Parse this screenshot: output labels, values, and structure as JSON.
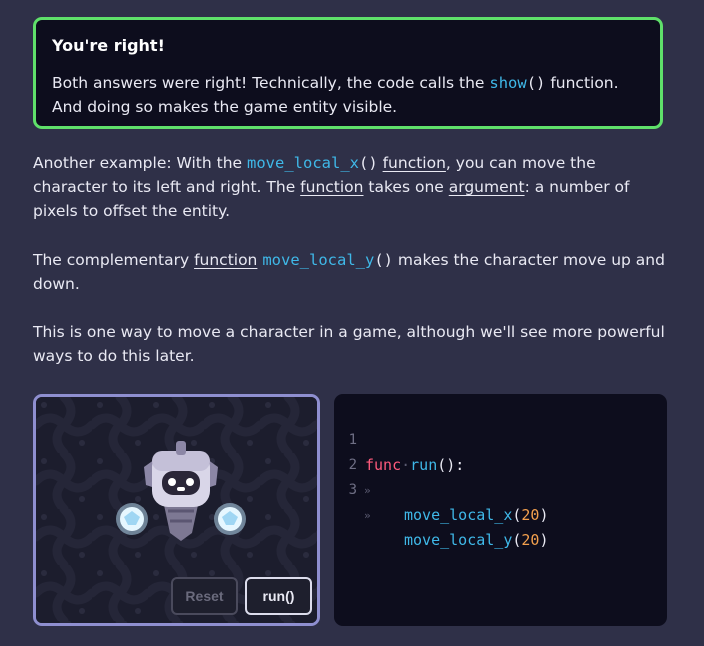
{
  "callout": {
    "title": "You're right!",
    "body_before": "Both answers were right! Technically, the code calls the ",
    "code": "show",
    "parens": "()",
    "body_after": " function. And doing so makes the game entity visible."
  },
  "paragraph1": {
    "t1": "Another example: With the ",
    "code": "move_local_x",
    "parens": "()",
    "space": " ",
    "link1": "function",
    "t2": ", you can move the character to its left and right. The ",
    "link2": "function",
    "t3": " takes one ",
    "link3": "argument",
    "t4": ": a number of pixels to offset the entity."
  },
  "paragraph2": {
    "t1": "The complementary ",
    "link1": "function",
    "space": " ",
    "code": "move_local_y",
    "parens": "()",
    "t2": " makes the character move up and down."
  },
  "paragraph3": {
    "text": "This is one way to move a character in a game, although we'll see more powerful ways to do this later."
  },
  "stage": {
    "reset_label": "Reset",
    "run_label": "run()",
    "character_icon": "robot-character-icon"
  },
  "editor": {
    "lines": [
      {
        "num": "1",
        "kw": "func",
        "dot": "·",
        "fn": "run",
        "rest": "():"
      },
      {
        "num": "2",
        "tab": "»",
        "fn": "move_local_x",
        "open": "(",
        "arg": "20",
        "close": ")"
      },
      {
        "num": "3",
        "tab": "»",
        "fn": "move_local_y",
        "open": "(",
        "arg": "20",
        "close": ")"
      }
    ]
  },
  "colors": {
    "background": "#2f3048",
    "callout_border": "#5fe06a",
    "code_blue": "#3fb8e8",
    "keyword": "#ff5a7c",
    "number": "#f3a04e"
  }
}
